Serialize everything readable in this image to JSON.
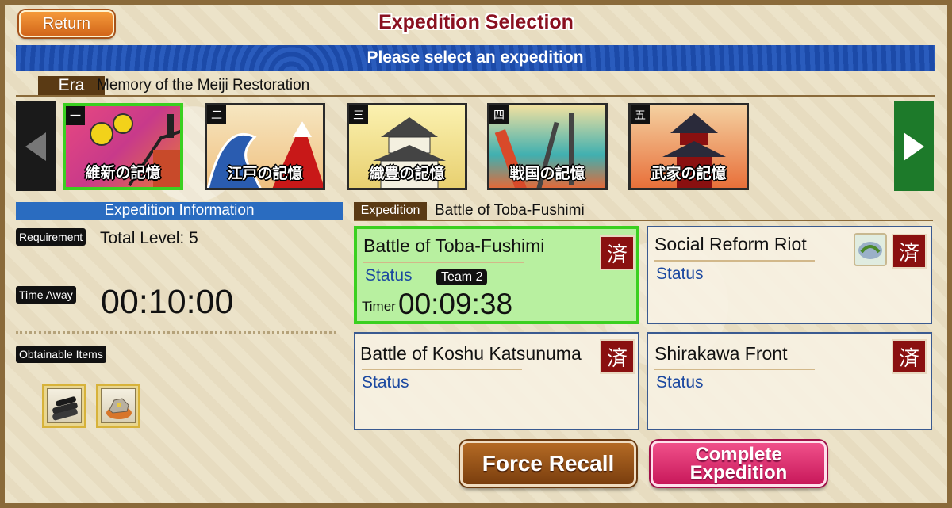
{
  "header": {
    "return_label": "Return",
    "title": "Expedition Selection",
    "banner": "Please select an expedition"
  },
  "era": {
    "tag": "Era",
    "name": "Memory of the Meiji Restoration",
    "cards": [
      {
        "num": "一",
        "label": "維新の記憶",
        "selected": true
      },
      {
        "num": "二",
        "label": "江戸の記憶",
        "selected": false
      },
      {
        "num": "三",
        "label": "織豊の記憶",
        "selected": false
      },
      {
        "num": "四",
        "label": "戦国の記憶",
        "selected": false
      },
      {
        "num": "五",
        "label": "武家の記憶",
        "selected": false
      }
    ]
  },
  "info": {
    "heading": "Expedition Information",
    "requirement_label": "Requirement",
    "requirement_value": "Total Level: 5",
    "time_away_label": "Time Away",
    "time_away_value": "00:10:00",
    "obtainable_label": "Obtainable Items",
    "items": [
      "charcoal-item-icon",
      "ore-item-icon"
    ]
  },
  "expedition": {
    "tag": "Expedition",
    "selected_name": "Battle of Toba-Fushimi",
    "cards": [
      {
        "name": "Battle of Toba-Fushimi",
        "status": "Status",
        "badge": "済",
        "team": "Team 2",
        "timer_label": "Timer",
        "timer": "00:09:38",
        "active": true
      },
      {
        "name": "Social Reform Riot",
        "status": "Status",
        "badge": "済",
        "reward_icon": "rice-seedling-icon"
      },
      {
        "name": "Battle of Koshu Katsunuma",
        "status": "Status",
        "badge": "済"
      },
      {
        "name": "Shirakawa Front",
        "status": "Status",
        "badge": "済"
      }
    ]
  },
  "actions": {
    "force_recall": "Force Recall",
    "complete_line1": "Complete",
    "complete_line2": "Expedition"
  },
  "colors": {
    "accent_green": "#3ad020",
    "title_red": "#8a1020",
    "banner_blue": "#2050b0",
    "status_blue": "#1b48a0",
    "badge_red": "#8a1010"
  }
}
